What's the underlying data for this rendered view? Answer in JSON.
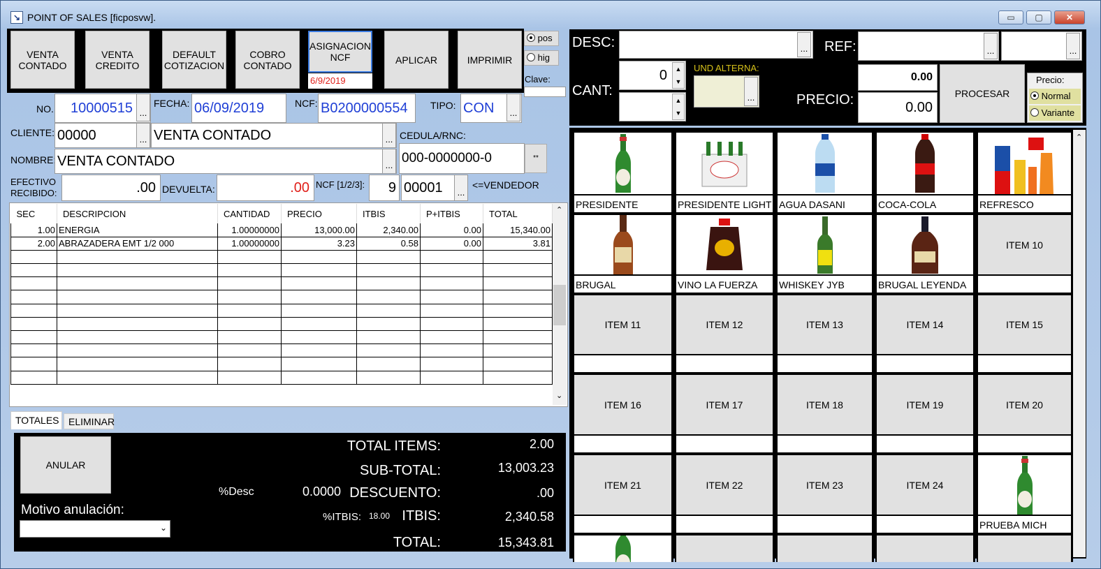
{
  "window": {
    "title": "POINT OF SALES [ficposvw].",
    "min": "▭",
    "max": "▢",
    "close": "✕"
  },
  "toolbar": {
    "venta_contado": "VENTA CONTADO",
    "venta_credito": "VENTA CREDITO",
    "default_cotizacion": "DEFAULT COTIZACION",
    "cobro_contado": "COBRO CONTADO",
    "asignacion_ncf": "ASIGNACION NCF",
    "asignacion_date": "6/9/2019",
    "aplicar": "APLICAR",
    "imprimir": "IMPRIMIR",
    "opt_pos": "pos",
    "opt_hig": "hig",
    "clave_label": "Clave:"
  },
  "header": {
    "no_label": "NO.",
    "no": "10000515",
    "fecha_label": "FECHA:",
    "fecha": "06/09/2019",
    "ncf_label": "NCF:",
    "ncf": "B0200000554",
    "tipo_label": "TIPO:",
    "tipo": "CON",
    "cliente_label": "CLIENTE:",
    "cliente_code": "00000",
    "cliente_name": "VENTA CONTADO",
    "cedula_label": "CEDULA/RNC:",
    "cedula": "000-0000000-0",
    "nombre_label": "NOMBRE:",
    "nombre": "VENTA CONTADO",
    "efectivo_label_1": "EFECTIVO",
    "efectivo_label_2": "RECIBIDO:",
    "efectivo": ".00",
    "devuelta_label": "DEVUELTA:",
    "devuelta": ".00",
    "ncf_type_label": "NCF [1/2/3]:",
    "ncf_type": "9",
    "vendedor": "00001",
    "vendedor_label": "<=VENDEDOR",
    "dots": "...",
    "star": "**"
  },
  "grid": {
    "columns": [
      "SEC",
      "DESCRIPCION",
      "CANTIDAD",
      "PRECIO",
      "ITBIS",
      "P+ITBIS",
      "TOTAL"
    ],
    "rows": [
      [
        "1.00",
        "ENERGIA",
        "1.00000000",
        "13,000.00",
        "2,340.00",
        "0.00",
        "15,340.00"
      ],
      [
        "2.00",
        "ABRAZADERA EMT 1/2 000",
        "1.00000000",
        "3.23",
        "0.58",
        "0.00",
        "3.81"
      ]
    ]
  },
  "tabs": {
    "totales": "TOTALES",
    "eliminar": "ELIMINAR"
  },
  "totals": {
    "anular": "ANULAR",
    "motivo_label": "Motivo anulación:",
    "desc_label": "%Desc",
    "desc_pct": "0.0000",
    "total_items_label": "TOTAL ITEMS:",
    "total_items": "2.00",
    "subtotal_label": "SUB-TOTAL:",
    "subtotal": "13,003.23",
    "descuento_label": "DESCUENTO:",
    "descuento": ".00",
    "itbis_pct_label": "%ITBIS:",
    "itbis_pct": "18.00",
    "itbis_label": "ITBIS:",
    "itbis": "2,340.58",
    "total_label": "TOTAL:",
    "total": "15,343.81"
  },
  "entry": {
    "desc_label": "DESC:",
    "ref_label": "REF:",
    "cant_label": "CANT:",
    "cant": "0",
    "und_label": "UND ALTERNA:",
    "precio_label": "PRECIO:",
    "precio_top": "0.00",
    "precio": "0.00",
    "procesar": "PROCESAR",
    "precio_group": "Precio:",
    "normal": "Normal",
    "variante": "Variante"
  },
  "products": [
    {
      "label": "PRESIDENTE",
      "img": "beer"
    },
    {
      "label": "PRESIDENTE LIGHT",
      "img": "pack"
    },
    {
      "label": "AGUA DASANI",
      "img": "water"
    },
    {
      "label": "COCA-COLA",
      "img": "cola"
    },
    {
      "label": "REFRESCO",
      "img": "soda"
    },
    {
      "label": "BRUGAL",
      "img": "rum"
    },
    {
      "label": "VINO LA FUERZA",
      "img": "wine"
    },
    {
      "label": "WHISKEY JYB",
      "img": "whisky"
    },
    {
      "label": "BRUGAL LEYENDA",
      "img": "leyenda"
    },
    {
      "label": "",
      "text": "ITEM 10"
    },
    {
      "label": "",
      "text": "ITEM 11"
    },
    {
      "label": "",
      "text": "ITEM 12"
    },
    {
      "label": "",
      "text": "ITEM 13"
    },
    {
      "label": "",
      "text": "ITEM 14"
    },
    {
      "label": "",
      "text": "ITEM 15"
    },
    {
      "label": "",
      "text": "ITEM 16"
    },
    {
      "label": "",
      "text": "ITEM 17"
    },
    {
      "label": "",
      "text": "ITEM 18"
    },
    {
      "label": "",
      "text": "ITEM 19"
    },
    {
      "label": "",
      "text": "ITEM 20"
    },
    {
      "label": "",
      "text": "ITEM 21"
    },
    {
      "label": "",
      "text": "ITEM 22"
    },
    {
      "label": "",
      "text": "ITEM 23"
    },
    {
      "label": "",
      "text": "ITEM 24"
    },
    {
      "label": "PRUEBA MICH",
      "img": "beer"
    }
  ]
}
